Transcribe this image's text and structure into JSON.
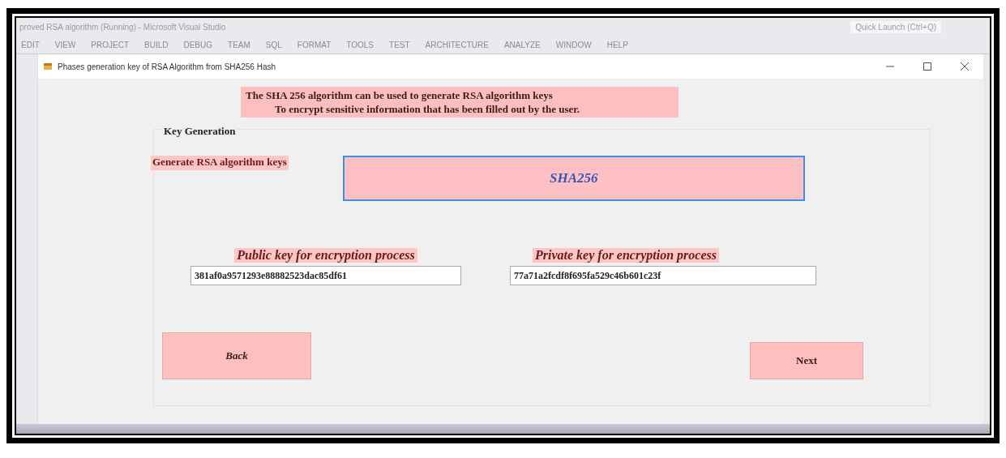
{
  "ide": {
    "title": "proved RSA algorithm (Running) - Microsoft Visual Studio",
    "quick_launch": "Quick Launch (Ctrl+Q)",
    "menu": [
      "EDIT",
      "VIEW",
      "PROJECT",
      "BUILD",
      "DEBUG",
      "TEAM",
      "SQL",
      "FORMAT",
      "TOOLS",
      "TEST",
      "ARCHITECTURE",
      "ANALYZE",
      "WINDOW",
      "HELP"
    ]
  },
  "window": {
    "title": "Phases generation key of RSA Algorithm from  SHA256 Hash"
  },
  "banner": [
    "The SHA 256 algorithm can be used to generate RSA algorithm keys",
    "To encrypt sensitive information that has been filled out by the user."
  ],
  "group": {
    "title": "Key Generation",
    "generate_label": "Generate RSA algorithm keys",
    "hash_button": "SHA256",
    "keys": [
      {
        "label": "Public key for encryption process",
        "value": "381af0a9571293e88882523dac85df61"
      },
      {
        "label": "Private key for encryption process",
        "value": "77a71a2fcdf8f695fa529c46b601c23f"
      }
    ],
    "buttons": [
      "Back",
      "Next"
    ]
  }
}
